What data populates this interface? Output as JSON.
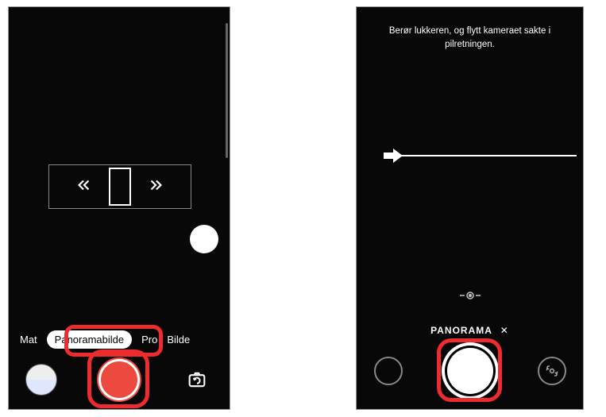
{
  "left": {
    "modes": {
      "prev": "Mat",
      "selected": "Panoramabilde",
      "next1": "Pro",
      "next2": "Bilde"
    },
    "icons": {
      "chevrons_left": "chevrons-left-icon",
      "chevrons_right": "chevrons-right-icon",
      "thumbnail": "gallery-thumbnail",
      "shutter": "shutter-button",
      "switch": "switch-camera-icon"
    }
  },
  "right": {
    "instruction_line1": "Berør lukkeren, og flytt kameraet sakte i",
    "instruction_line2": "pilretningen.",
    "mode_label": "PANORAMA",
    "close_glyph": "✕",
    "icons": {
      "arrow": "direction-arrow-icon",
      "focus": "focus-target-icon",
      "ring": "back-ring-button",
      "shutter": "shutter-button",
      "switch": "switch-camera-icon"
    }
  }
}
